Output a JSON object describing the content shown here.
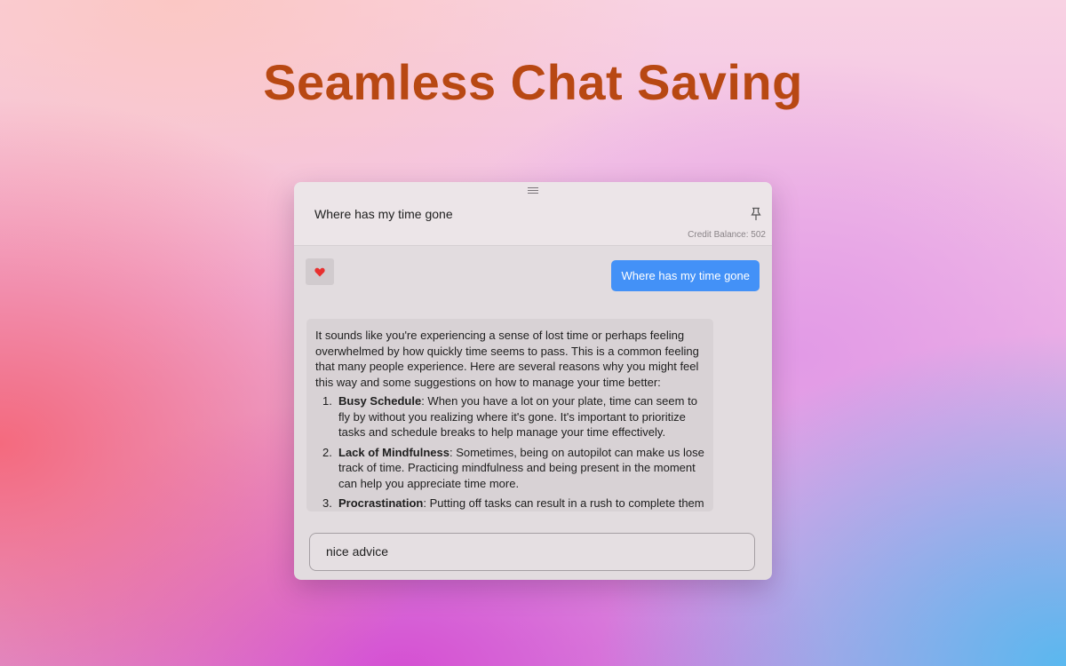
{
  "hero": {
    "title": "Seamless Chat Saving"
  },
  "window": {
    "title": "Where has my time gone",
    "credit_balance": "Credit Balance: 502",
    "icons": {
      "drag": "drag-handle-icon",
      "pin": "pin-icon",
      "heart": "heart-icon"
    }
  },
  "messages": {
    "user": "Where has my time gone",
    "assistant": {
      "intro": "It sounds like you're experiencing a sense of lost time or perhaps feeling overwhelmed by how quickly time seems to pass. This is a common feeling that many people experience. Here are several reasons why you might feel this way and some suggestions on how to manage your time better:",
      "items": [
        {
          "num": "1.",
          "term": "Busy Schedule",
          "text": ": When you have a lot on your plate, time can seem to fly by without you realizing where it's gone. It's important to prioritize tasks and schedule breaks to help manage your time effectively."
        },
        {
          "num": "2.",
          "term": "Lack of Mindfulness",
          "text": ": Sometimes, being on autopilot can make us lose track of time. Practicing mindfulness and being present in the moment can help you appreciate time more."
        },
        {
          "num": "3.",
          "term": "Procrastination",
          "text": ": Putting off tasks can result in a rush to complete them"
        }
      ]
    }
  },
  "input": {
    "value": "nice advice"
  },
  "colors": {
    "title": "#b84813",
    "user_bubble": "#4391f7",
    "heart": "#e8302f"
  }
}
